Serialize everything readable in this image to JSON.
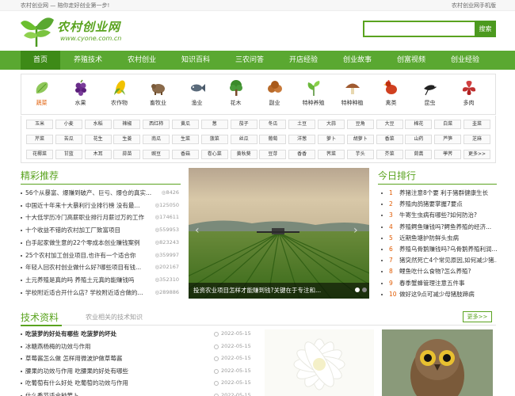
{
  "topbar": {
    "left": "农村创业网 — 陪你走好创业第一步!",
    "right": "农村创业网手机版"
  },
  "logo": {
    "title": "农村创业网",
    "url": "www.cyone.com.cn"
  },
  "search": {
    "placeholder": "",
    "button": "搜索"
  },
  "nav": [
    "首页",
    "养殖技术",
    "农村创业",
    "知识百科",
    "三农问答",
    "开店经验",
    "创业故事",
    "创富视频",
    "创业经验"
  ],
  "categories": [
    {
      "label": "蔬菜",
      "icon": "vegetable-icon",
      "color": "#7ab84a"
    },
    {
      "label": "水果",
      "icon": "grape-icon",
      "color": "#6a2d8a"
    },
    {
      "label": "农作物",
      "icon": "corn-icon",
      "color": "#e6b800"
    },
    {
      "label": "畜牧业",
      "icon": "livestock-icon",
      "color": "#8a5a3a"
    },
    {
      "label": "渔业",
      "icon": "fish-icon",
      "color": "#667788"
    },
    {
      "label": "花木",
      "icon": "tree-icon",
      "color": "#3b8a2a"
    },
    {
      "label": "副业",
      "icon": "mushroom-icon",
      "color": "#b06a2a"
    },
    {
      "label": "特种养殖",
      "icon": "plant-icon",
      "color": "#5aa831"
    },
    {
      "label": "特种种植",
      "icon": "shiitake-icon",
      "color": "#a05a30"
    },
    {
      "label": "禽类",
      "icon": "chicken-icon",
      "color": "#d04020"
    },
    {
      "label": "昆虫",
      "icon": "bird-icon",
      "color": "#333333"
    },
    {
      "label": "多肉",
      "icon": "succulent-icon",
      "color": "#c03030"
    }
  ],
  "tags": [
    [
      "玉米",
      "小麦",
      "水稻",
      "辣椒",
      "西红柿",
      "黄瓜",
      "葱",
      "茄子",
      "冬瓜",
      "土豆",
      "大蒜",
      "豆角",
      "大豆",
      "棉花",
      "白菜",
      "韭菜"
    ],
    [
      "芹菜",
      "苦瓜",
      "花生",
      "生姜",
      "南瓜",
      "生菜",
      "菠菜",
      "丝瓜",
      "葡萄",
      "洋葱",
      "萝卜",
      "胡萝卜",
      "香菜",
      "山药",
      "芦笋",
      "芝麻"
    ],
    [
      "花椰菜",
      "甘蓝",
      "木耳",
      "蒜苗",
      "豌豆",
      "香菇",
      "卷心菜",
      "黄秋葵",
      "豆芽",
      "香香",
      "荠菜",
      "芋头",
      "芥菜",
      "茼蒿",
      "荸荠",
      "更多>>"
    ]
  ],
  "featured": {
    "title": "精彩推荐",
    "items": [
      {
        "t": "56个从暴富、爆赚到破产、巨亏、爆仓的真实...",
        "v": "8426"
      },
      {
        "t": "中国近十年来十大暴利行业排行榜 没有最...",
        "v": "125050"
      },
      {
        "t": "十大低学历冷门高薪职业排行月薪过万的工作",
        "v": "174611"
      },
      {
        "t": "十个收益不错的农村加工厂致富项目",
        "v": "559953"
      },
      {
        "t": "白手起家做生意的22个零成本创业赚钱案例",
        "v": "823243"
      },
      {
        "t": "25个农村加工创业项目,也许有一个适合你",
        "v": "359997"
      },
      {
        "t": "年轻人回农村创业做什么好?哪些项目有钱...",
        "v": "202167"
      },
      {
        "t": "土元养殖是真的吗 养殖土元真的能赚钱吗",
        "v": "352310"
      },
      {
        "t": "学校附近适合开什么店? 学校附近适合做的...",
        "v": "289886"
      }
    ]
  },
  "slide": {
    "caption": "投资农业项目怎样才能赚到钱?关键在于专注和..."
  },
  "ranking": {
    "title": "今日排行",
    "items": [
      {
        "n": "1",
        "t": "养猪注意8个要 利于猪群健康生长"
      },
      {
        "n": "2",
        "t": "养殖肉鸽猪要掌握7要点"
      },
      {
        "n": "3",
        "t": "牛寄生虫病有哪些?如何防治?"
      },
      {
        "n": "4",
        "t": "养殖鳄鱼赚钱吗?鳄鱼养殖的经济..."
      },
      {
        "n": "5",
        "t": "近期鱼塘护防鲜头虫病"
      },
      {
        "n": "6",
        "t": "养殖乌骨鹅赚钱吗?乌骨鹅养殖利润..."
      },
      {
        "n": "7",
        "t": "猪突然死亡4个常见原因,如何减少猪..."
      },
      {
        "n": "8",
        "t": "鲤鱼吃什么食物?怎么养殖?"
      },
      {
        "n": "9",
        "t": "春季蟹蜂管理注意五件事"
      },
      {
        "n": "10",
        "t": "做好这9点可减少母猪肢蹄病"
      }
    ]
  },
  "tech": {
    "title": "技术资料",
    "subtitle": "农业相关的技术知识",
    "more": "更多>>",
    "items": [
      {
        "t": "吃菠萝的好处有哪些 吃菠萝的坏处",
        "d": "2022-05-15",
        "bold": true
      },
      {
        "t": "冰糖燕杨梅的功效与作用",
        "d": "2022-05-15"
      },
      {
        "t": "草莓酱怎么做 怎样用微波炉做草莓酱",
        "d": "2022-05-15"
      },
      {
        "t": "腰果的功效与作用 吃腰果的好处有哪些",
        "d": "2022-05-15"
      },
      {
        "t": "吃葡萄有什么好处 吃葡萄的功效与作用",
        "d": "2022-05-15"
      },
      {
        "t": "什么季节适合种萝卜",
        "d": "2022-05-15"
      }
    ]
  }
}
